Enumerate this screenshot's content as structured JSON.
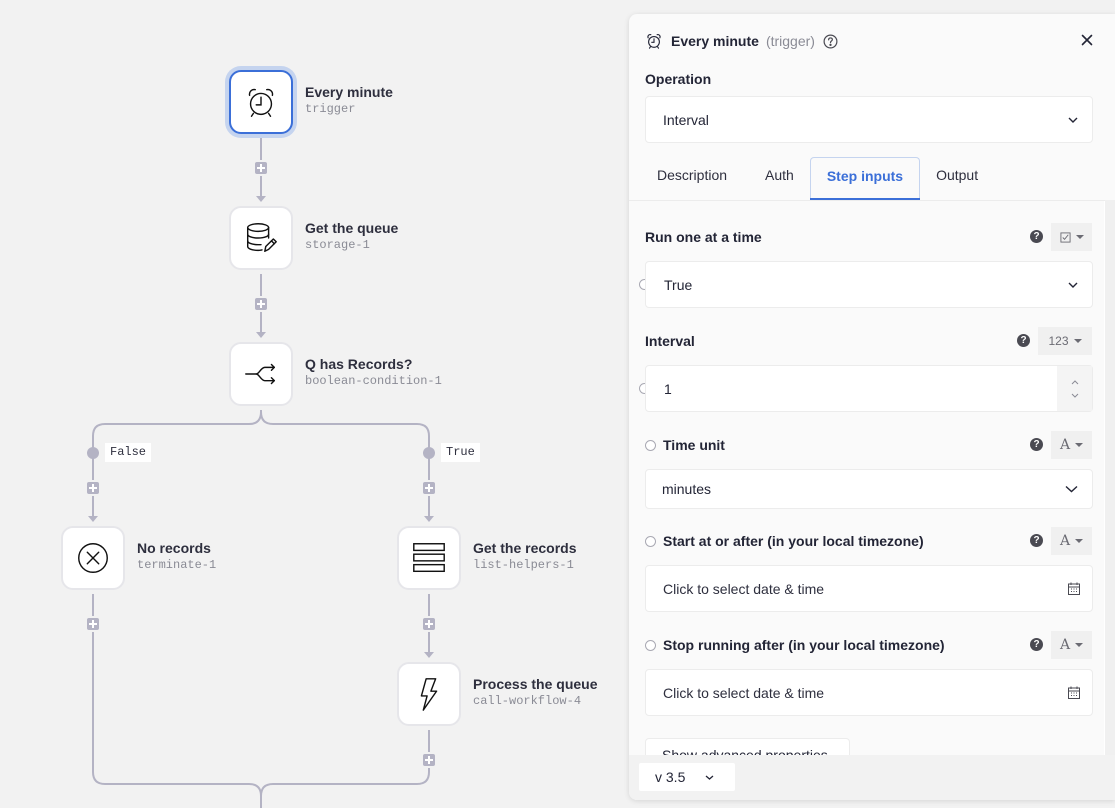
{
  "workflow": {
    "nodes": [
      {
        "id": "trigger",
        "title": "Every minute",
        "subtitle": "trigger",
        "icon": "alarm-clock-icon",
        "selected": true
      },
      {
        "id": "storage",
        "title": "Get the queue",
        "subtitle": "storage-1",
        "icon": "database-edit-icon",
        "selected": false
      },
      {
        "id": "condition",
        "title": "Q has Records?",
        "subtitle": "boolean-condition-1",
        "icon": "branch-icon",
        "selected": false
      },
      {
        "id": "terminate",
        "title": "No records",
        "subtitle": "terminate-1",
        "icon": "circle-x-icon",
        "selected": false
      },
      {
        "id": "list",
        "title": "Get the records",
        "subtitle": "list-helpers-1",
        "icon": "list-rows-icon",
        "selected": false
      },
      {
        "id": "callwf",
        "title": "Process the queue",
        "subtitle": "call-workflow-4",
        "icon": "lightning-icon",
        "selected": false
      }
    ],
    "branches": {
      "false_label": "False",
      "true_label": "True"
    }
  },
  "panel": {
    "header": {
      "title": "Every minute",
      "subtitle": "(trigger)",
      "icon": "alarm-clock-icon"
    },
    "operation": {
      "label": "Operation",
      "value": "Interval"
    },
    "tabs": [
      {
        "label": "Description",
        "active": false
      },
      {
        "label": "Auth",
        "active": false
      },
      {
        "label": "Step inputs",
        "active": true
      },
      {
        "label": "Output",
        "active": false
      }
    ],
    "fields": {
      "run_one": {
        "label": "Run one at a time",
        "type_icon": "checkbox-icon",
        "value": "True"
      },
      "interval": {
        "label": "Interval",
        "type_label": "123",
        "value": "1"
      },
      "time_unit": {
        "label": "Time unit",
        "type_label": "A",
        "value": "minutes"
      },
      "start_at": {
        "label": "Start at or after (in your local timezone)",
        "type_label": "A",
        "placeholder": "Click to select date & time"
      },
      "stop_after": {
        "label": "Stop running after (in your local timezone)",
        "type_label": "A",
        "placeholder": "Click to select date & time"
      }
    },
    "advanced_button": "Show advanced properties",
    "version": "v 3.5"
  },
  "colors": {
    "accent": "#3b6fd8",
    "accent_light": "#c5d4ef",
    "wire": "#b4b3c4",
    "canvas_bg": "#f2f2f2"
  }
}
